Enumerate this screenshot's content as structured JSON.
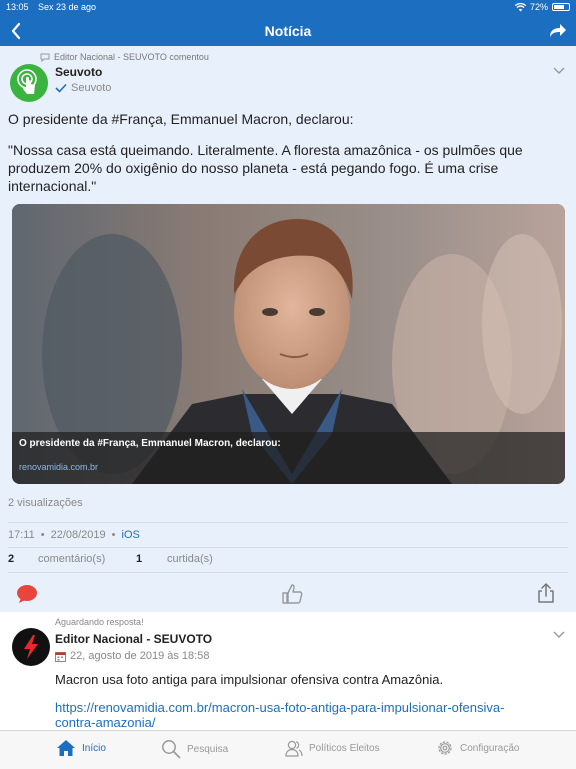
{
  "status_bar": {
    "time": "13:05",
    "date": "Sex 23 de ago",
    "battery": "72%",
    "battery_level": 0.72
  },
  "nav": {
    "title": "Notícia"
  },
  "post": {
    "activity": "Editor Nacional - SEUVOTO comentou",
    "author": "Seuvoto",
    "verified_label": "Seuvoto",
    "intro": "O presidente da #França, Emmanuel Macron, declarou:",
    "quote": "\"Nossa casa está queimando. Literalmente. A floresta amazônica - os pulmões que produzem 20% do oxigênio do nosso planeta - está pegando fogo. É uma crise internacional.\"",
    "card": {
      "title": "O presidente da #França, Emmanuel Macron, declarou:",
      "domain": "renovamidia.com.br"
    },
    "views": "2 visualizações",
    "time": "17:11",
    "date": "22/08/2019",
    "platform": "iOS",
    "comments_count": "2",
    "comments_label": "comentário(s)",
    "likes_count": "1",
    "likes_label": "curtida(s)"
  },
  "post2": {
    "status": "Aguardando resposta!",
    "author": "Editor Nacional - SEUVOTO",
    "date": "22, agosto de 2019 às 18:58",
    "text": "Macron usa foto antiga para impulsionar ofensiva contra Amazônia.",
    "link": "https://renovamidia.com.br/macron-usa-foto-antiga-para-impulsionar-ofensiva-contra-amazonia/"
  },
  "tabs": [
    {
      "label": "Início",
      "icon": "home-icon",
      "active": true
    },
    {
      "label": "Pesquisa",
      "icon": "search-icon"
    },
    {
      "label": "Políticos Eleitos",
      "icon": "people-icon"
    },
    {
      "label": "Configuração",
      "icon": "gear-icon"
    }
  ],
  "colors": {
    "primary": "#1c6fc0",
    "background": "#e8f1fb",
    "accent_red": "#e8453c",
    "logo_green": "#3bb33f"
  }
}
